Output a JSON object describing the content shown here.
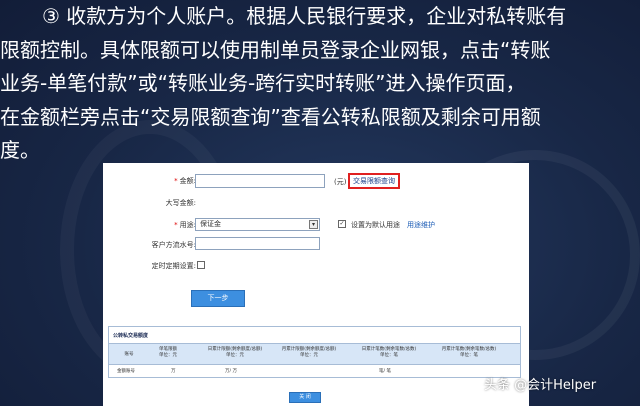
{
  "paragraph": {
    "line1": "③ 收款方为个人账户。根据人民银行要求，企业对私转账有",
    "line2": "限额控制。具体限额可以使用制单员登录企业网银，点击“转账",
    "line3": "业务-单笔付款”或“转账业务-跨行实时转账”进入操作页面，",
    "line4": "在金额栏旁点击“交易限额查询”查看公转私限额及剩余可用额",
    "line5": "度。"
  },
  "form": {
    "amount_label": "金额:",
    "amount_unit": "(元)",
    "limit_query_link": "交易限额查询",
    "uppercase_amount_label": "大写金额:",
    "purpose_label": "用途:",
    "purpose_value": "保证金",
    "default_purpose_label": "设置为默认用途",
    "purpose_maintain_link": "用途维护",
    "serial_label": "客户方流水号:",
    "scheduled_label": "定时定期设置:",
    "next_button": "下一步"
  },
  "limits_table": {
    "title": "公转私交易额度",
    "headers": [
      "账号",
      "单笔限额",
      "日累计限额(剩余额度/总额)",
      "月累计限额(剩余额度/总额)",
      "日累计笔数(剩余笔数/总数)",
      "月累计笔数(剩余笔数/总数)"
    ],
    "unit_row": [
      "",
      "单位：元",
      "单位：元",
      "单位：元",
      "单位：笔",
      "单位：笔"
    ],
    "data_row": [
      "金额账号",
      "万",
      "万/   万",
      "",
      "笔/   笔",
      ""
    ]
  },
  "bottom_button": "关 闭",
  "credit": "头条 @会计Helper",
  "colors": {
    "background": "#182746",
    "highlight_box": "#e02020",
    "button": "#3d8fe0",
    "link": "#1a5bb5"
  }
}
